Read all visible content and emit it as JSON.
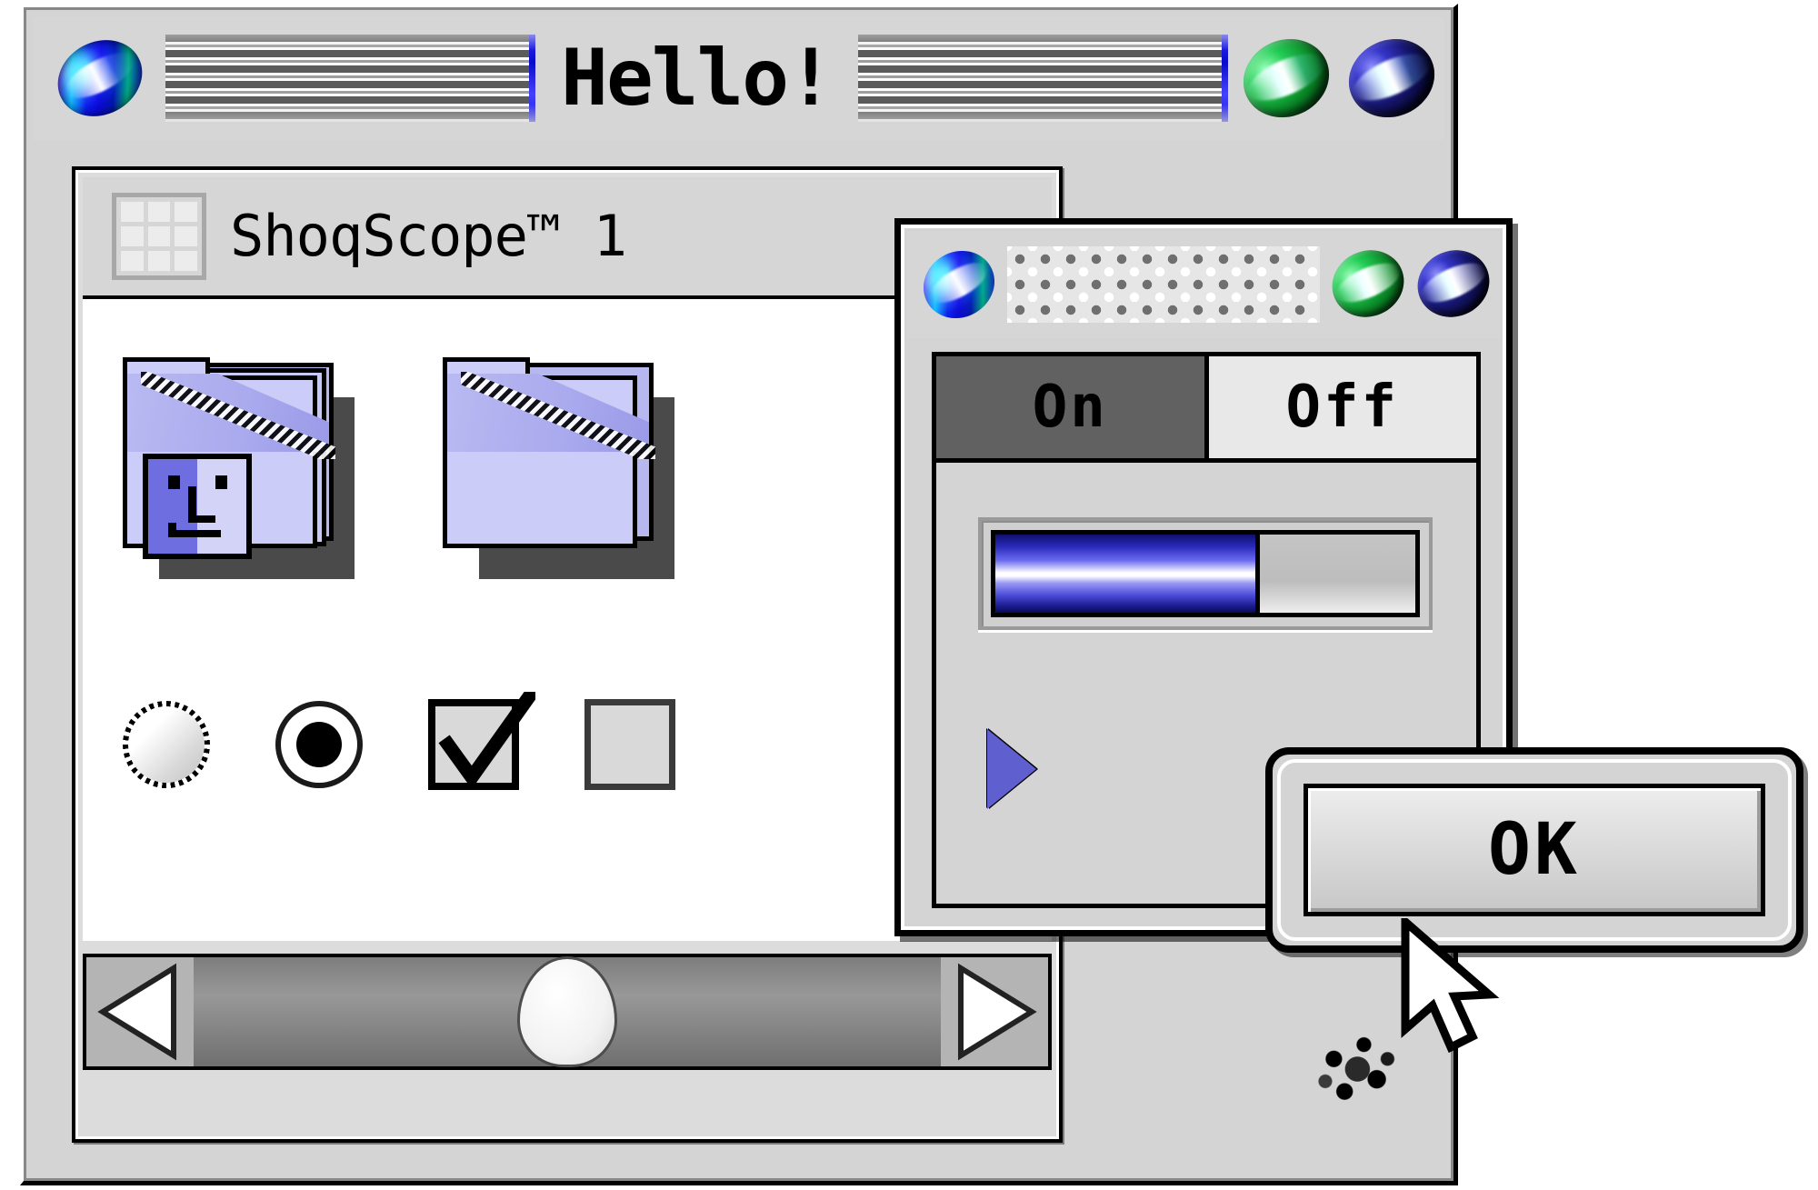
{
  "main_window": {
    "title": "Hello!",
    "icons": {
      "app_disc": "cd-disc-icon",
      "zoom_orb": "green-orb-button",
      "close_orb": "blue-orb-button",
      "pinstripe_left": "titlebar-pinstripe-left",
      "pinstripe_right": "titlebar-pinstripe-right"
    }
  },
  "panel": {
    "title": "ShoqScope™ 1",
    "grid_icon": "grid-3x3-icon",
    "items": [
      {
        "label": "",
        "icon": "folder-with-finder-face-icon"
      },
      {
        "label": "",
        "icon": "folder-icon"
      }
    ],
    "controls": [
      {
        "name": "radio-unselected",
        "type": "radio",
        "checked": false
      },
      {
        "name": "radio-selected",
        "type": "radio",
        "checked": true
      },
      {
        "name": "checkbox-checked",
        "type": "checkbox",
        "checked": true
      },
      {
        "name": "checkbox-unchecked",
        "type": "checkbox",
        "checked": false
      }
    ],
    "scrollbar": {
      "left_arrow": "scroll-left-arrow",
      "right_arrow": "scroll-right-arrow",
      "thumb": "scroll-thumb",
      "position_pct": 50
    },
    "corner_icon": "grow-box-icon"
  },
  "dialog": {
    "titlebar_pattern": "dotted-pattern",
    "icons": {
      "app_disc": "cd-disc-icon",
      "zoom_orb": "green-orb-button",
      "close_orb": "blue-orb-button"
    },
    "tabs": [
      {
        "label": "On",
        "selected": true
      },
      {
        "label": "Off",
        "selected": false
      }
    ],
    "progress": {
      "value_pct": 62,
      "name": "progress-bar"
    },
    "disclosure_triangle": {
      "name": "disclosure-triangle-icon",
      "expanded": false
    }
  },
  "ok_button": {
    "label": "OK",
    "default": true
  },
  "cursor": {
    "name": "arrow-pointer"
  },
  "colors": {
    "window_bg": "#d4d4d4",
    "panel_bg": "#dcdcdc",
    "content_bg": "#ffffff",
    "folder": "#ccccf8",
    "folder_dark": "#6e6ee0",
    "progress_blue": "#2b2bbd",
    "tab_selected": "#616161",
    "accent_green": "#22cc55"
  }
}
